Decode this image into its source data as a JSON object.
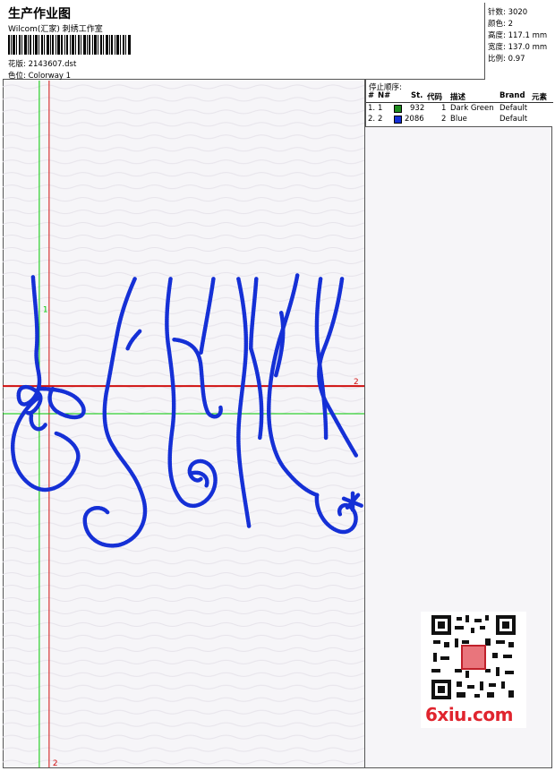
{
  "header": {
    "title": "生产作业图",
    "company": "Wilcom(汇家) 刺绣工作室",
    "design_label": "花版:",
    "design_value": "2143607.dst",
    "colorway_label": "色位:",
    "colorway_value": "Colorway 1"
  },
  "stats": {
    "stitches_label": "针数:",
    "stitches_value": "3020",
    "colors_label": "颜色:",
    "colors_value": "2",
    "height_label": "高度:",
    "height_value": "117.1 mm",
    "width_label": "宽度:",
    "width_value": "137.0 mm",
    "scale_label": "比例:",
    "scale_value": "0.97"
  },
  "stop_sequence": {
    "title": "停止顺序:",
    "columns": [
      "#",
      "N#",
      "St.",
      "代码",
      "描述",
      "Brand",
      "元素"
    ],
    "rows": [
      {
        "idx": "1.",
        "n": "1",
        "color": "#1e8b1e",
        "st": "932",
        "code": "1",
        "desc": "Dark Green",
        "brand": "Default"
      },
      {
        "idx": "2.",
        "n": "2",
        "color": "#1530d6",
        "st": "2086",
        "code": "2",
        "desc": "Blue",
        "brand": "Default"
      }
    ]
  },
  "guides": {
    "green_top_label": "1",
    "red_right_label": "2",
    "red_bottom_label": "2",
    "green_color": "#00c800",
    "red_color": "#d01010",
    "stitch_color": "#1530d6"
  },
  "watermark": {
    "text": "6xiu.com"
  }
}
